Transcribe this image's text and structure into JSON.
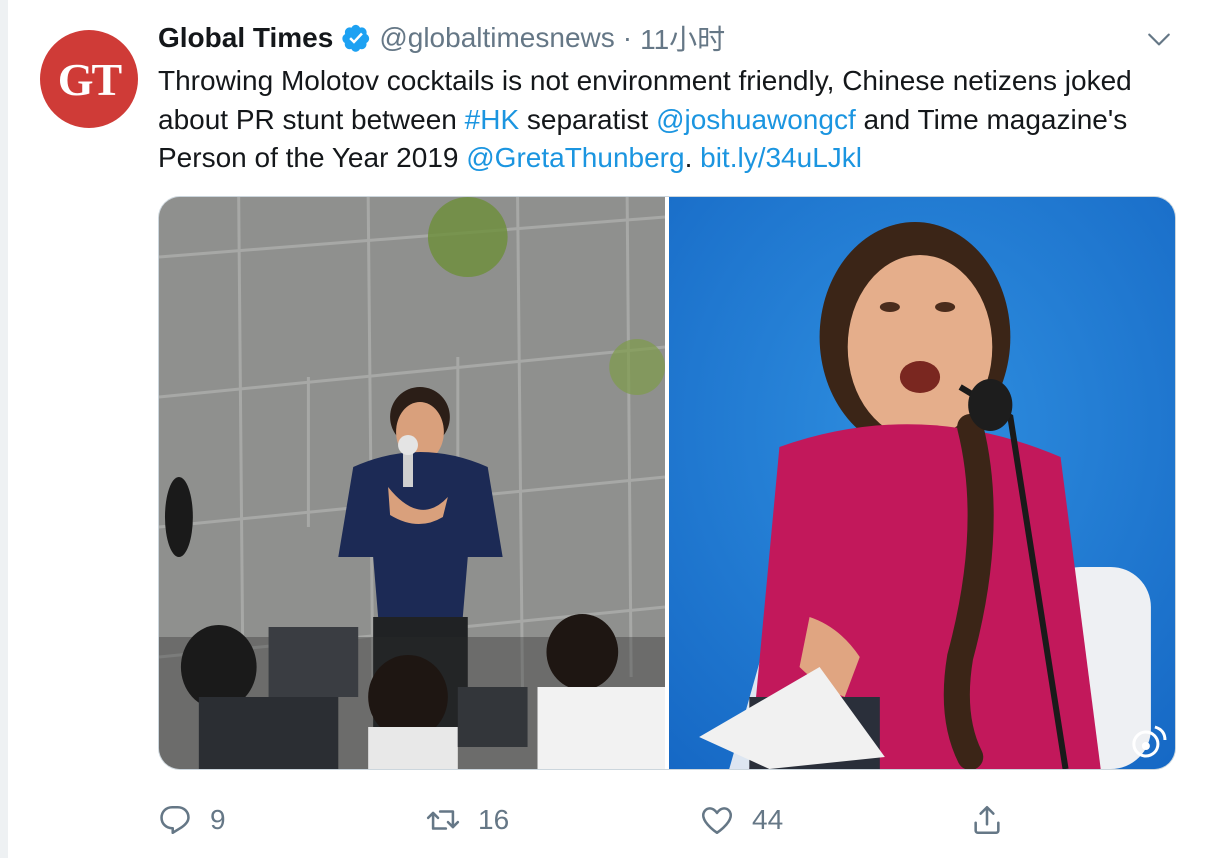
{
  "tweet": {
    "avatar_text": "GT",
    "author_name": "Global Times",
    "handle": "@globaltimesnews",
    "separator": "·",
    "time": "11小时",
    "text_1": "Throwing Molotov cocktails is not environment friendly, Chinese netizens joked about PR stunt between ",
    "hashtag": "#HK",
    "text_2": " separatist ",
    "mention_1": "@joshuawongcf",
    "text_3": " and Time magazine's Person of the Year 2019 ",
    "mention_2": "@GretaThunberg",
    "text_4": ". ",
    "link": "bit.ly/34uLJkl",
    "icons": [
      "verified-badge-icon",
      "chevron-down-icon",
      "reply-icon",
      "retweet-icon",
      "like-icon",
      "share-icon",
      "weibo-watermark-icon"
    ]
  },
  "actions": {
    "replies": "9",
    "retweets": "16",
    "likes": "44"
  },
  "colors": {
    "link": "#1b95e0",
    "muted": "#657786",
    "avatar_bg": "#cf3b37",
    "verified": "#1da1f2"
  }
}
